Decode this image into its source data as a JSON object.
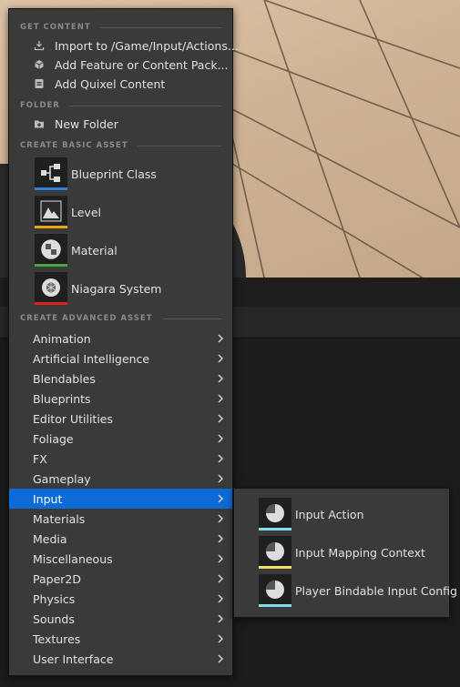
{
  "menu": {
    "sections": {
      "get_content": "GET CONTENT",
      "folder": "FOLDER",
      "create_basic_asset": "CREATE BASIC ASSET",
      "create_advanced_asset": "CREATE ADVANCED ASSET"
    },
    "get_content_items": [
      {
        "label": "Import to /Game/Input/Actions...",
        "icon": "import-icon"
      },
      {
        "label": "Add Feature or Content Pack...",
        "icon": "content-pack-icon"
      },
      {
        "label": "Add Quixel Content",
        "icon": "quixel-icon"
      }
    ],
    "folder_items": [
      {
        "label": "New Folder",
        "icon": "new-folder-icon"
      }
    ],
    "basic_assets": [
      {
        "label": "Blueprint Class",
        "icon": "blueprint-icon",
        "color": "#2f7fd9"
      },
      {
        "label": "Level",
        "icon": "level-icon",
        "color": "#e8a21a"
      },
      {
        "label": "Material",
        "icon": "material-icon",
        "color": "#43a843"
      },
      {
        "label": "Niagara System",
        "icon": "niagara-icon",
        "color": "#d62121"
      }
    ],
    "advanced_categories": [
      "Animation",
      "Artificial Intelligence",
      "Blendables",
      "Blueprints",
      "Editor Utilities",
      "Foliage",
      "FX",
      "Gameplay",
      "Input",
      "Materials",
      "Media",
      "Miscellaneous",
      "Paper2D",
      "Physics",
      "Sounds",
      "Textures",
      "User Interface"
    ],
    "active_category": "Input",
    "active_color": "#0d6bd8"
  },
  "submenu": {
    "items": [
      {
        "label": "Input Action",
        "icon": "input-action-icon",
        "color": "#7fe0e8"
      },
      {
        "label": "Input Mapping Context",
        "icon": "input-mapping-context-icon",
        "color": "#f0e06a"
      },
      {
        "label": "Player Bindable Input Config",
        "icon": "input-config-icon",
        "color": "#7fe0e8"
      }
    ]
  }
}
